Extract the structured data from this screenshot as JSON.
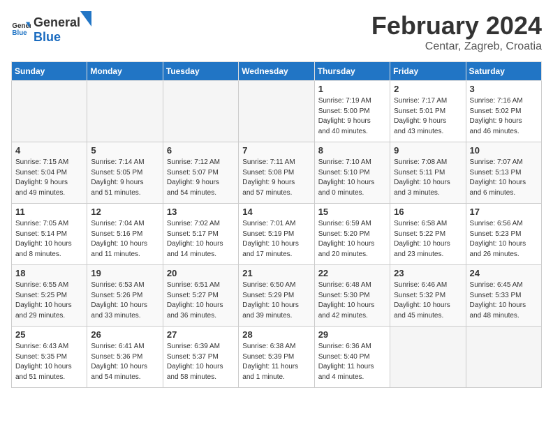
{
  "header": {
    "logo_general": "General",
    "logo_blue": "Blue",
    "month_title": "February 2024",
    "location": "Centar, Zagreb, Croatia"
  },
  "days_of_week": [
    "Sunday",
    "Monday",
    "Tuesday",
    "Wednesday",
    "Thursday",
    "Friday",
    "Saturday"
  ],
  "weeks": [
    [
      {
        "day": "",
        "info": ""
      },
      {
        "day": "",
        "info": ""
      },
      {
        "day": "",
        "info": ""
      },
      {
        "day": "",
        "info": ""
      },
      {
        "day": "1",
        "info": "Sunrise: 7:19 AM\nSunset: 5:00 PM\nDaylight: 9 hours\nand 40 minutes."
      },
      {
        "day": "2",
        "info": "Sunrise: 7:17 AM\nSunset: 5:01 PM\nDaylight: 9 hours\nand 43 minutes."
      },
      {
        "day": "3",
        "info": "Sunrise: 7:16 AM\nSunset: 5:02 PM\nDaylight: 9 hours\nand 46 minutes."
      }
    ],
    [
      {
        "day": "4",
        "info": "Sunrise: 7:15 AM\nSunset: 5:04 PM\nDaylight: 9 hours\nand 49 minutes."
      },
      {
        "day": "5",
        "info": "Sunrise: 7:14 AM\nSunset: 5:05 PM\nDaylight: 9 hours\nand 51 minutes."
      },
      {
        "day": "6",
        "info": "Sunrise: 7:12 AM\nSunset: 5:07 PM\nDaylight: 9 hours\nand 54 minutes."
      },
      {
        "day": "7",
        "info": "Sunrise: 7:11 AM\nSunset: 5:08 PM\nDaylight: 9 hours\nand 57 minutes."
      },
      {
        "day": "8",
        "info": "Sunrise: 7:10 AM\nSunset: 5:10 PM\nDaylight: 10 hours\nand 0 minutes."
      },
      {
        "day": "9",
        "info": "Sunrise: 7:08 AM\nSunset: 5:11 PM\nDaylight: 10 hours\nand 3 minutes."
      },
      {
        "day": "10",
        "info": "Sunrise: 7:07 AM\nSunset: 5:13 PM\nDaylight: 10 hours\nand 6 minutes."
      }
    ],
    [
      {
        "day": "11",
        "info": "Sunrise: 7:05 AM\nSunset: 5:14 PM\nDaylight: 10 hours\nand 8 minutes."
      },
      {
        "day": "12",
        "info": "Sunrise: 7:04 AM\nSunset: 5:16 PM\nDaylight: 10 hours\nand 11 minutes."
      },
      {
        "day": "13",
        "info": "Sunrise: 7:02 AM\nSunset: 5:17 PM\nDaylight: 10 hours\nand 14 minutes."
      },
      {
        "day": "14",
        "info": "Sunrise: 7:01 AM\nSunset: 5:19 PM\nDaylight: 10 hours\nand 17 minutes."
      },
      {
        "day": "15",
        "info": "Sunrise: 6:59 AM\nSunset: 5:20 PM\nDaylight: 10 hours\nand 20 minutes."
      },
      {
        "day": "16",
        "info": "Sunrise: 6:58 AM\nSunset: 5:22 PM\nDaylight: 10 hours\nand 23 minutes."
      },
      {
        "day": "17",
        "info": "Sunrise: 6:56 AM\nSunset: 5:23 PM\nDaylight: 10 hours\nand 26 minutes."
      }
    ],
    [
      {
        "day": "18",
        "info": "Sunrise: 6:55 AM\nSunset: 5:25 PM\nDaylight: 10 hours\nand 29 minutes."
      },
      {
        "day": "19",
        "info": "Sunrise: 6:53 AM\nSunset: 5:26 PM\nDaylight: 10 hours\nand 33 minutes."
      },
      {
        "day": "20",
        "info": "Sunrise: 6:51 AM\nSunset: 5:27 PM\nDaylight: 10 hours\nand 36 minutes."
      },
      {
        "day": "21",
        "info": "Sunrise: 6:50 AM\nSunset: 5:29 PM\nDaylight: 10 hours\nand 39 minutes."
      },
      {
        "day": "22",
        "info": "Sunrise: 6:48 AM\nSunset: 5:30 PM\nDaylight: 10 hours\nand 42 minutes."
      },
      {
        "day": "23",
        "info": "Sunrise: 6:46 AM\nSunset: 5:32 PM\nDaylight: 10 hours\nand 45 minutes."
      },
      {
        "day": "24",
        "info": "Sunrise: 6:45 AM\nSunset: 5:33 PM\nDaylight: 10 hours\nand 48 minutes."
      }
    ],
    [
      {
        "day": "25",
        "info": "Sunrise: 6:43 AM\nSunset: 5:35 PM\nDaylight: 10 hours\nand 51 minutes."
      },
      {
        "day": "26",
        "info": "Sunrise: 6:41 AM\nSunset: 5:36 PM\nDaylight: 10 hours\nand 54 minutes."
      },
      {
        "day": "27",
        "info": "Sunrise: 6:39 AM\nSunset: 5:37 PM\nDaylight: 10 hours\nand 58 minutes."
      },
      {
        "day": "28",
        "info": "Sunrise: 6:38 AM\nSunset: 5:39 PM\nDaylight: 11 hours\nand 1 minute."
      },
      {
        "day": "29",
        "info": "Sunrise: 6:36 AM\nSunset: 5:40 PM\nDaylight: 11 hours\nand 4 minutes."
      },
      {
        "day": "",
        "info": ""
      },
      {
        "day": "",
        "info": ""
      }
    ]
  ]
}
